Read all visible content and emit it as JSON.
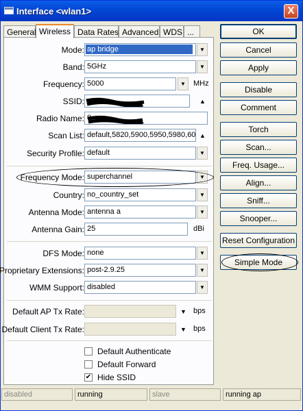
{
  "window": {
    "title": "Interface <wlan1>",
    "close": "X"
  },
  "tabs": [
    "General",
    "Wireless",
    "Data Rates",
    "Advanced",
    "WDS",
    "..."
  ],
  "fields": {
    "mode": {
      "label": "Mode:",
      "value": "ap bridge"
    },
    "band": {
      "label": "Band:",
      "value": "5GHz"
    },
    "frequency": {
      "label": "Frequency:",
      "value": "5000",
      "unit": "MHz"
    },
    "ssid": {
      "label": "SSID:",
      "value": ""
    },
    "radio_name": {
      "label": "Radio Name:",
      "value": "0"
    },
    "scan_list": {
      "label": "Scan List:",
      "value": "default,5820,5900,5950,5980,60"
    },
    "security_profile": {
      "label": "Security Profile:",
      "value": "default"
    },
    "frequency_mode": {
      "label": "Frequency Mode:",
      "value": "superchannel"
    },
    "country": {
      "label": "Country:",
      "value": "no_country_set"
    },
    "antenna_mode": {
      "label": "Antenna Mode:",
      "value": "antenna a"
    },
    "antenna_gain": {
      "label": "Antenna Gain:",
      "value": "25",
      "unit": "dBi"
    },
    "dfs_mode": {
      "label": "DFS Mode:",
      "value": "none"
    },
    "proprietary_extensions": {
      "label": "Proprietary Extensions:",
      "value": "post-2.9.25"
    },
    "wmm_support": {
      "label": "WMM Support:",
      "value": "disabled"
    },
    "default_ap_tx_rate": {
      "label": "Default AP Tx Rate:",
      "value": "",
      "unit": "bps"
    },
    "default_client_tx_rate": {
      "label": "Default Client Tx Rate:",
      "value": "",
      "unit": "bps"
    }
  },
  "checkboxes": {
    "default_authenticate": {
      "label": "Default Authenticate",
      "checked": false,
      "mark": ""
    },
    "default_forward": {
      "label": "Default Forward",
      "checked": false,
      "mark": ""
    },
    "hide_ssid": {
      "label": "Hide SSID",
      "checked": true,
      "mark": "✔"
    }
  },
  "buttons": {
    "ok": "OK",
    "cancel": "Cancel",
    "apply": "Apply",
    "disable": "Disable",
    "comment": "Comment",
    "torch": "Torch",
    "scan": "Scan...",
    "freq_usage": "Freq. Usage...",
    "align": "Align...",
    "sniff": "Sniff...",
    "snooper": "Snooper...",
    "reset_configuration": "Reset Configuration",
    "simple_mode": "Simple Mode"
  },
  "status": [
    "disabled",
    "running",
    "slave",
    "running ap"
  ],
  "icons": {
    "dropdown": "▼",
    "up": "▲",
    "down": "▼"
  },
  "colors": {
    "title_bar": "#0348d6",
    "selection": "#316ac5",
    "tab_highlight": "#e68b2c"
  }
}
